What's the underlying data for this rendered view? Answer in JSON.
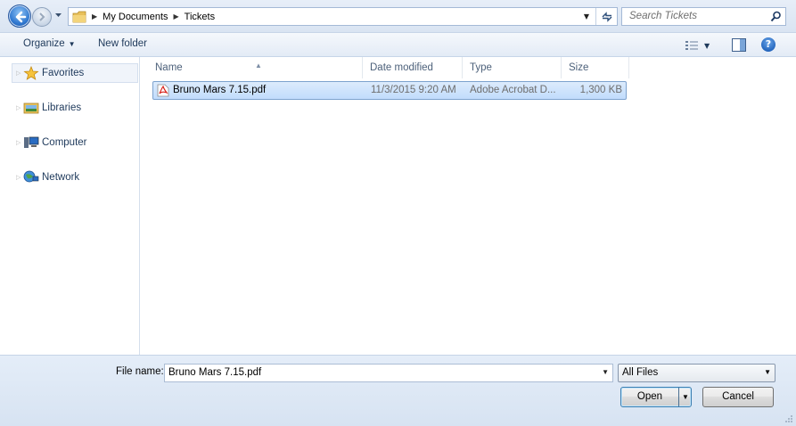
{
  "address_bar": {
    "breadcrumbs": [
      "My Documents",
      "Tickets"
    ]
  },
  "search": {
    "placeholder": "Search Tickets"
  },
  "toolbar": {
    "organize_label": "Organize",
    "new_folder_label": "New folder"
  },
  "nav_pane": {
    "items": [
      {
        "label": "Favorites",
        "icon": "star-icon"
      },
      {
        "label": "Libraries",
        "icon": "libraries-icon"
      },
      {
        "label": "Computer",
        "icon": "computer-icon"
      },
      {
        "label": "Network",
        "icon": "network-icon"
      }
    ]
  },
  "file_list": {
    "columns": [
      "Name",
      "Date modified",
      "Type",
      "Size"
    ],
    "rows": [
      {
        "name": "Bruno Mars 7.15.pdf",
        "date_modified": "11/3/2015 9:20 AM",
        "type": "Adobe Acrobat D...",
        "size": "1,300 KB",
        "icon": "pdf-icon",
        "selected": true
      }
    ]
  },
  "footer": {
    "file_name_label": "File name:",
    "file_name_value": "Bruno Mars 7.15.pdf",
    "file_type_value": "All Files",
    "open_label": "Open",
    "cancel_label": "Cancel"
  },
  "colors": {
    "selection": "#c1dcfc",
    "selection_border": "#7da2ce",
    "chrome": "#dfe9f5"
  }
}
